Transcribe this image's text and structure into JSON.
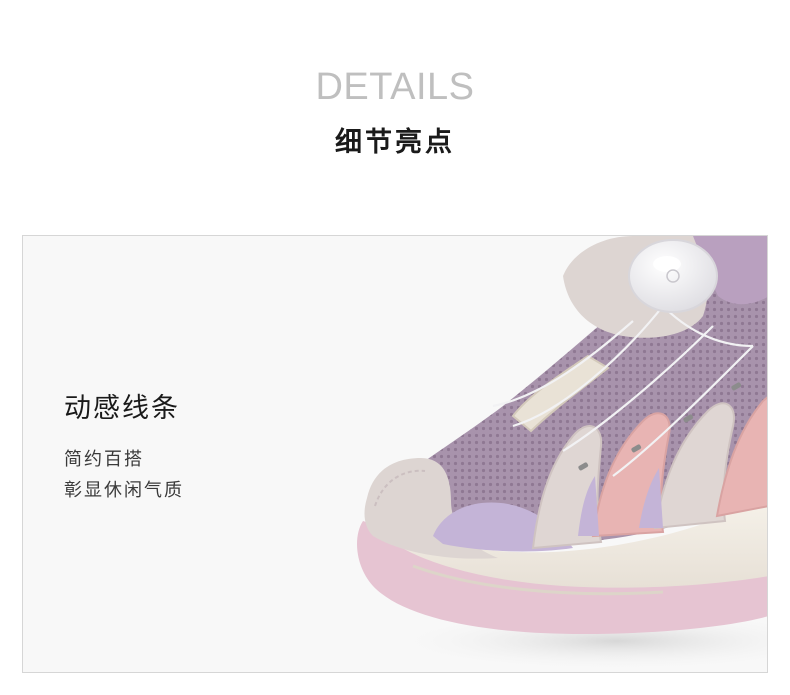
{
  "header": {
    "title_en": "DETAILS",
    "title_cn": "细节亮点"
  },
  "feature": {
    "title": "动感线条",
    "lines": [
      "简约百搭",
      "彰显休闲气质"
    ]
  },
  "image": {
    "subject": "shoe-closeup",
    "colors": {
      "background": "#f8f8f8",
      "mesh": "#a690aa",
      "suede": "#ddd6d3",
      "overlay_pink": "#e8b5b3",
      "overlay_lavender": "#c3b3d6",
      "sole": "#f1ede6",
      "sole_edge": "#e1c4d1"
    }
  }
}
